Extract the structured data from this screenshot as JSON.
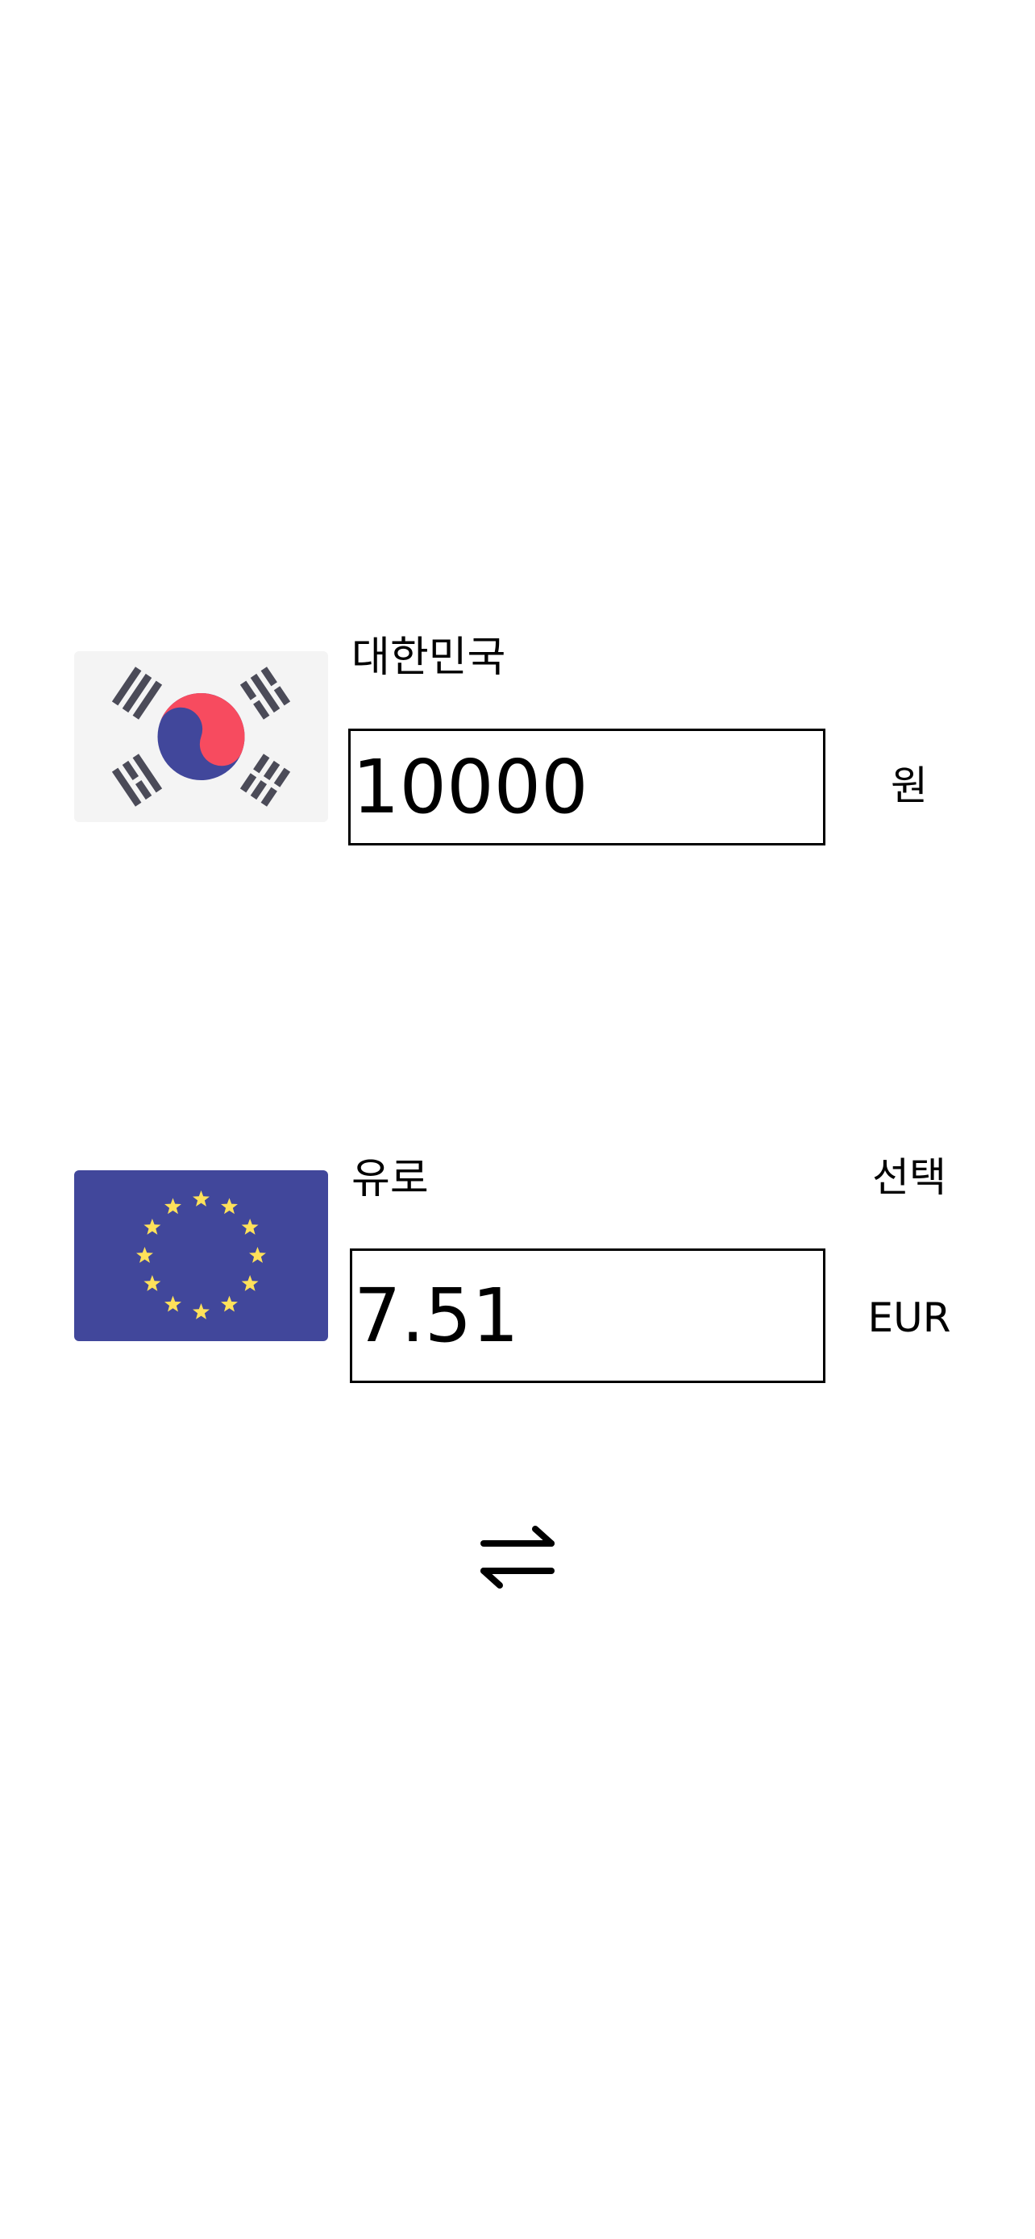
{
  "source": {
    "country": "대한민국",
    "amount": "10000",
    "unit": "원",
    "flag_icon": "south-korea-flag-icon"
  },
  "target": {
    "country": "유로",
    "amount": "7.51",
    "select_label": "선택",
    "currency_code": "EUR",
    "flag_icon": "eu-flag-icon"
  },
  "swap": {
    "icon": "swap-arrows-icon"
  },
  "colors": {
    "background": "#ffffff",
    "kr_flag_bg": "#f4f4f4",
    "kr_red": "#f74b5f",
    "kr_blue": "#41479b",
    "kr_trigram": "#4b4b58",
    "eu_blue": "#41479b",
    "eu_star": "#ffe15a"
  }
}
